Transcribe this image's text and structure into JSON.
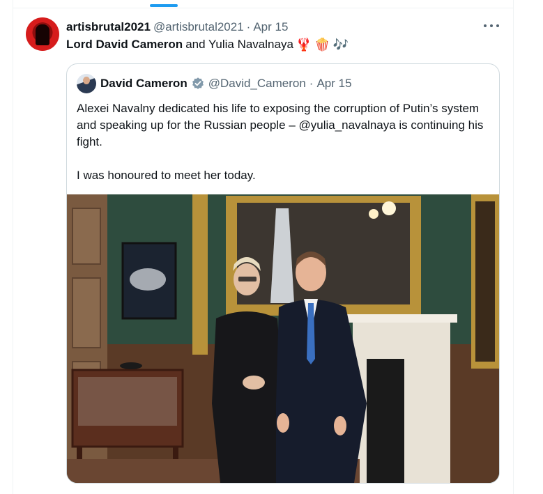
{
  "post": {
    "display_name": "artisbrutal2021",
    "handle": "@artisbrutal2021",
    "separator": "·",
    "date": "Apr 15",
    "text_bold": "Lord David Cameron",
    "text_rest": "and Yulia Navalnaya",
    "emojis": [
      "🦞",
      "🍿",
      "🎶"
    ],
    "more_icon": "more-horizontal-icon"
  },
  "quote": {
    "display_name": "David Cameron",
    "verified_icon": "verified-badge-icon",
    "handle": "@David_Cameron",
    "separator": "·",
    "date": "Apr 15",
    "text_line1": "Alexei Navalny dedicated his life to exposing the corruption of Putin’s system and speaking up for the Russian people – @yulia_navalnaya is continuing his fight.",
    "text_line2": "I was honoured to meet her today.",
    "media": "photo"
  },
  "colors": {
    "accent": "#1d9bf0",
    "text_primary": "#0f1419",
    "text_secondary": "#536471",
    "border": "#cfd9de"
  }
}
